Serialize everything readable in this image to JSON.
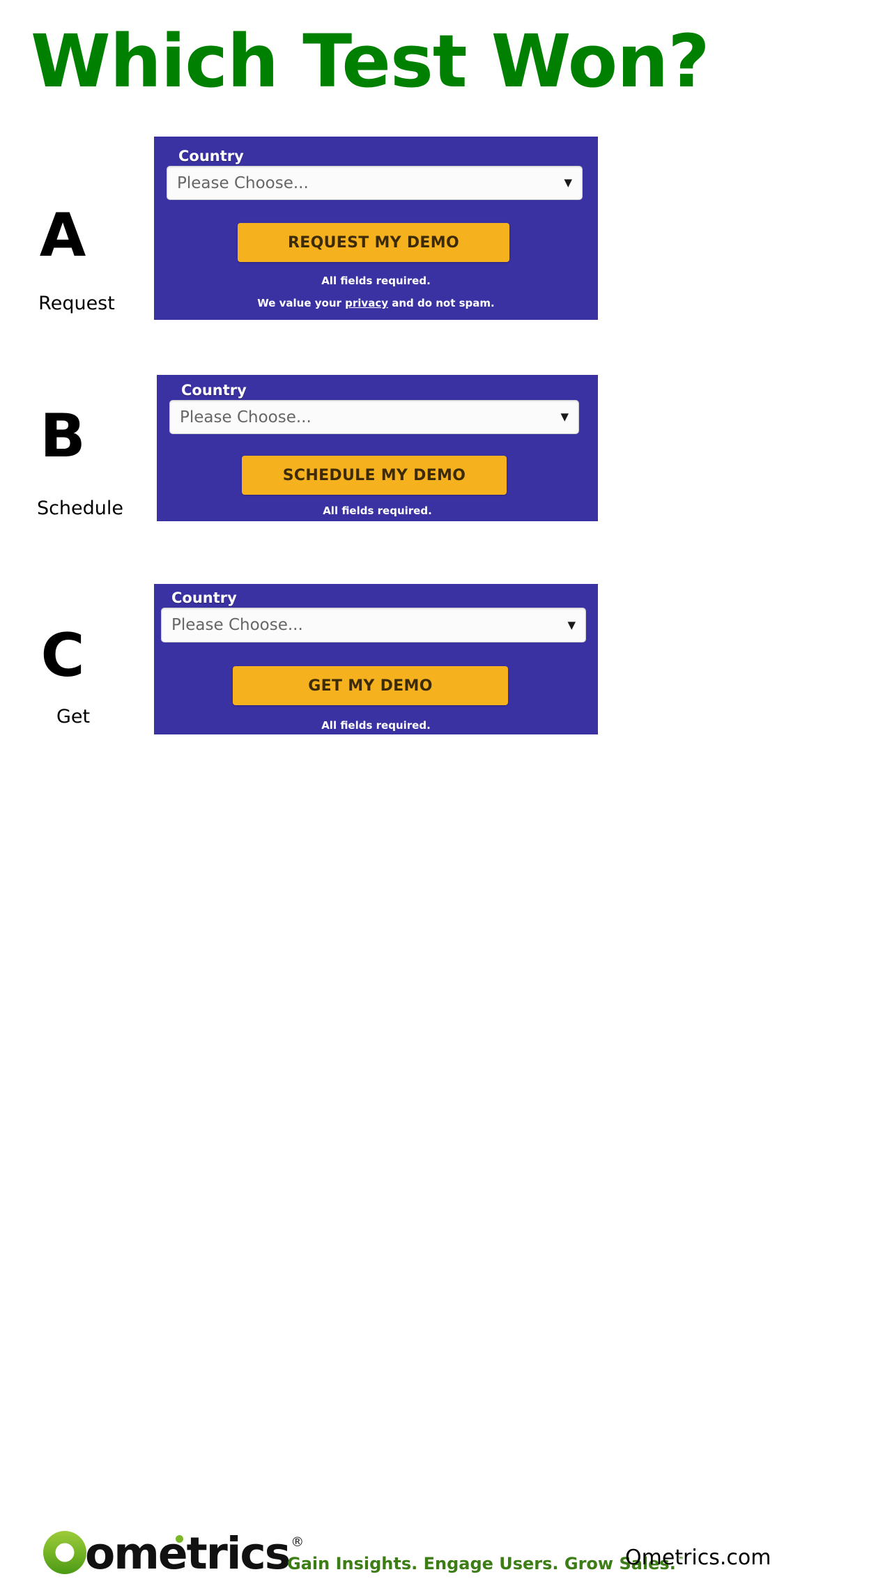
{
  "title": "Which Test Won?",
  "brand": {
    "green": "#008000",
    "panel_purple": "#3a31a3",
    "cta_orange": "#f5b21e",
    "logo_green": "#7ab728"
  },
  "variants": [
    {
      "letter": "A",
      "word": "Request",
      "field_label": "Country",
      "select_value": "Please Choose...",
      "caret": "▼",
      "cta_label": "REQUEST MY DEMO",
      "note_required": "All fields required.",
      "privacy_prefix": "We value your ",
      "privacy_link": "privacy",
      "privacy_suffix": " and do not spam."
    },
    {
      "letter": "B",
      "word": "Schedule",
      "field_label": "Country",
      "select_value": "Please Choose...",
      "caret": "▼",
      "cta_label": "SCHEDULE MY DEMO",
      "note_required": "All fields required."
    },
    {
      "letter": "C",
      "word": "Get",
      "field_label": "Country",
      "select_value": "Please Choose...",
      "caret": "▼",
      "cta_label": "GET MY DEMO",
      "note_required": "All fields required."
    }
  ],
  "footer": {
    "logo_text": "ometrics",
    "logo_registered": "®",
    "tagline": "Gain Insights.  Engage Users.  Grow Sales.",
    "tagline_tm": "™",
    "site_url": "Ometrics.com"
  }
}
